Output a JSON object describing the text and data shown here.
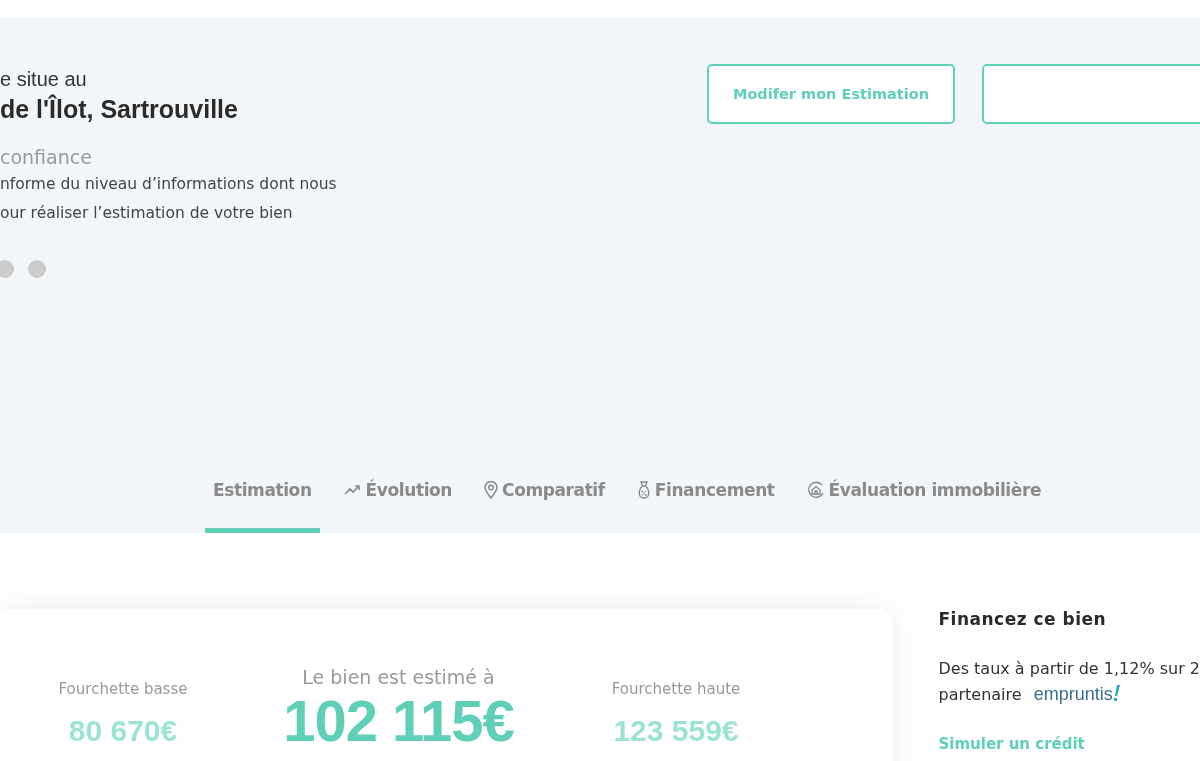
{
  "hero": {
    "intro": "e situe au",
    "address": "de l'Îlot, Sartrouville",
    "confidence_title": "confiance",
    "confidence_lines": [
      "nforme du niveau d’informations dont nous",
      "our réaliser l’estimation de votre bien"
    ],
    "dots": [
      {
        "selected": false
      },
      {
        "selected": false
      }
    ],
    "buttons": [
      "Modifer mon Estimation"
    ]
  },
  "tabs": [
    {
      "label": "Estimation",
      "kind": "plain",
      "selected": true
    },
    {
      "label": "Évolution",
      "kind": "trend",
      "selected": false
    },
    {
      "label": "Comparatif",
      "kind": "pin",
      "selected": false
    },
    {
      "label": "Financement",
      "kind": "bag",
      "selected": false
    },
    {
      "label": "Évaluation immobilière",
      "kind": "house",
      "selected": false
    }
  ],
  "estimate": {
    "low_label": "Fourchette basse",
    "low_value": "80 670€",
    "main_label": "Le bien est estimé à",
    "main_value": "102 115€",
    "high_label": "Fourchette haute",
    "high_value": "123 559€"
  },
  "financing": {
    "title": "Financez ce bien",
    "text_line": "Des taux à partir de 1,12% sur 2",
    "partner_label": "partenaire",
    "partner_logo": "empruntis",
    "link": "Simuler un crédit"
  }
}
